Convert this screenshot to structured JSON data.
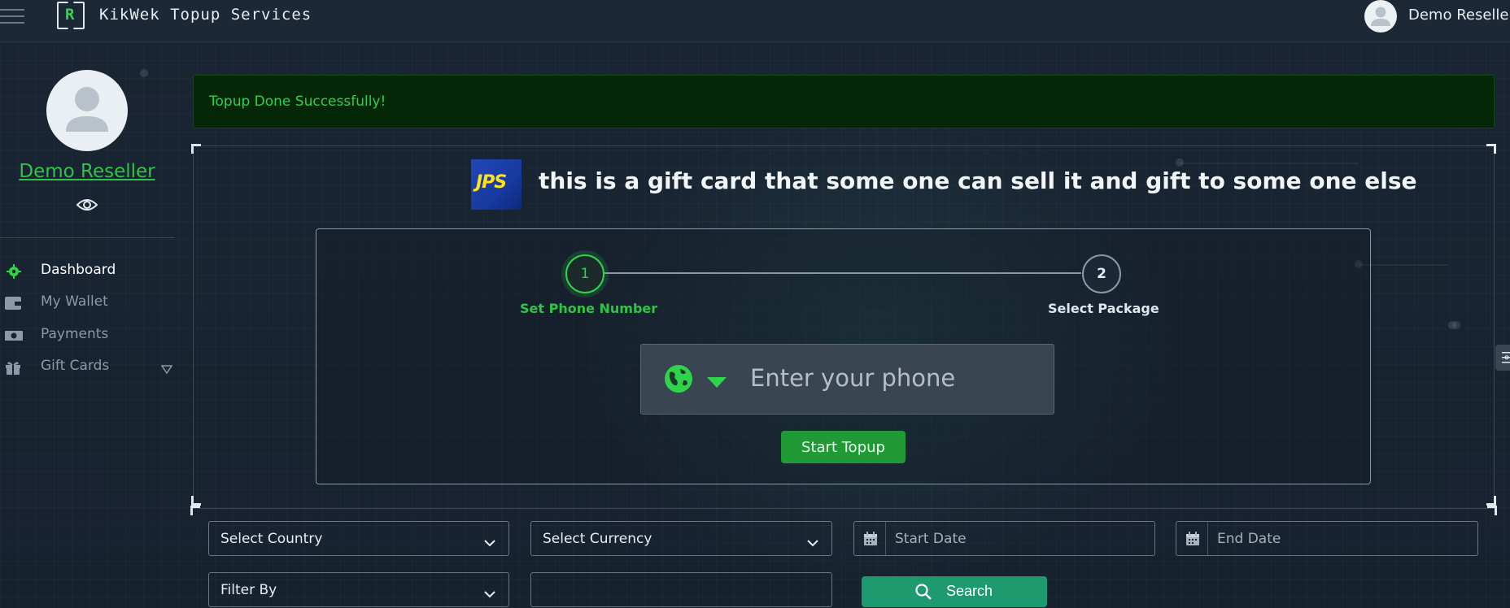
{
  "header": {
    "logo_letter": "R",
    "app_title": "KikWek Topup Services",
    "user_name": "Demo Reseller"
  },
  "sidebar": {
    "user_name": "Demo Reseller",
    "items": [
      {
        "label": "Dashboard",
        "icon": "gear-icon",
        "active": true
      },
      {
        "label": "My Wallet",
        "icon": "wallet-icon",
        "active": false
      },
      {
        "label": "Payments",
        "icon": "money-icon",
        "active": false
      },
      {
        "label": "Gift Cards",
        "icon": "gift-icon",
        "active": false
      }
    ]
  },
  "alert": {
    "message": "Topup Done Successfully!"
  },
  "card": {
    "logo_text": "JPS",
    "heading": "this is a gift card that some one can sell it and gift to some one else",
    "steps": [
      {
        "number": "1",
        "label": "Set Phone Number",
        "active": true
      },
      {
        "number": "2",
        "label": "Select Package",
        "active": false
      }
    ],
    "phone_placeholder": "Enter your phone",
    "start_button": "Start Topup"
  },
  "filters": {
    "country": "Select Country",
    "currency": "Select Currency",
    "start_date": "Start Date",
    "end_date": "End Date",
    "filter_by": "Filter By",
    "search_button": "Search"
  },
  "colors": {
    "accent_green": "#2fd44a",
    "success_bg": "#042807",
    "button_green": "#1f9a34",
    "search_teal": "#1e9a6f",
    "background": "#182331"
  }
}
